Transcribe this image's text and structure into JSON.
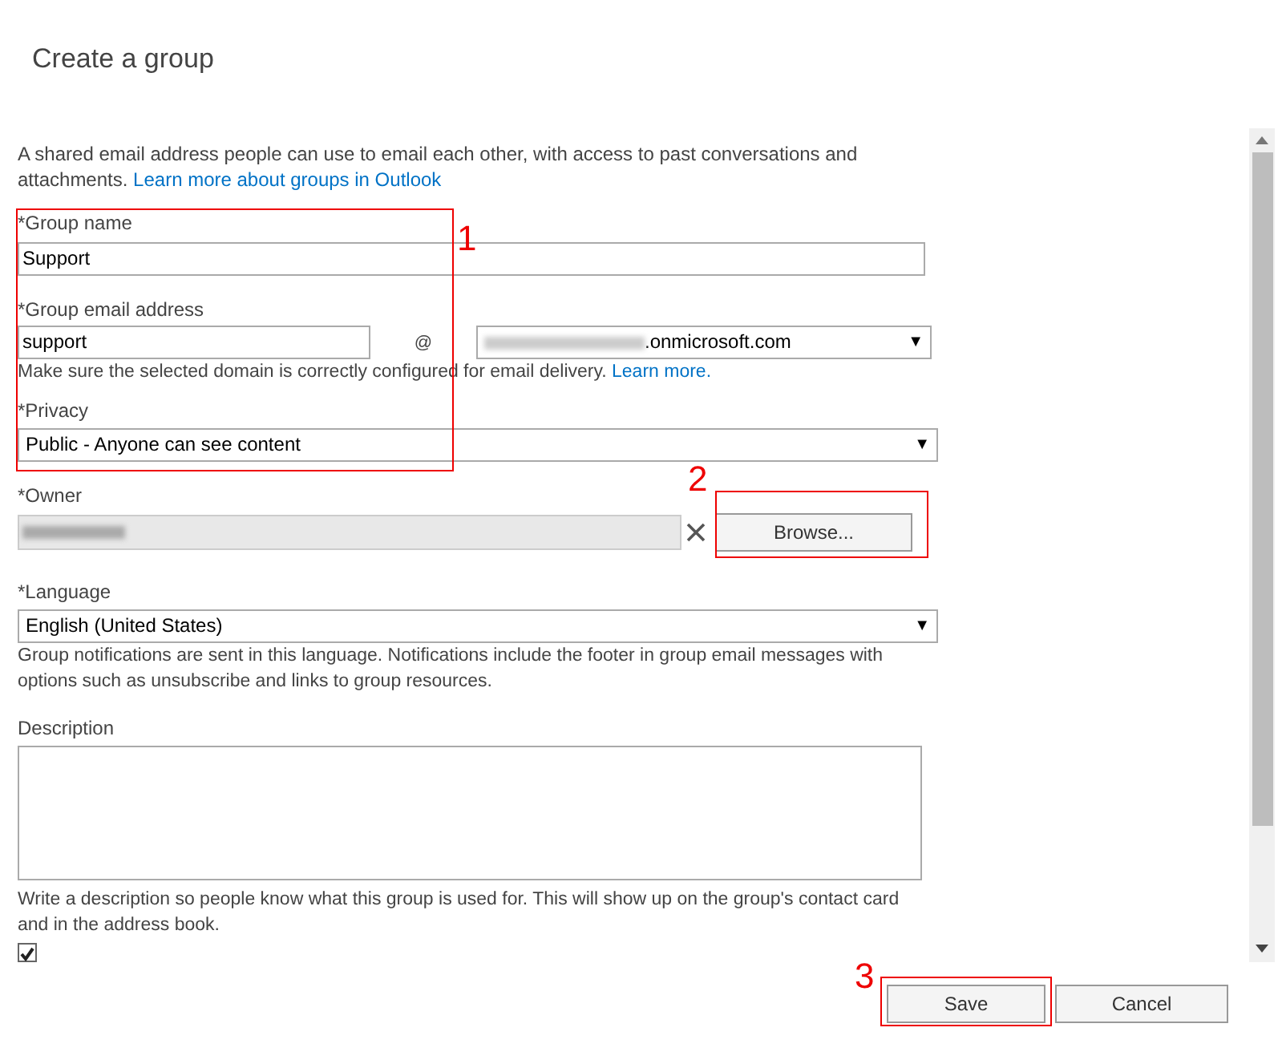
{
  "title": "Create a group",
  "intro": {
    "text": "A shared email address people can use to email each other, with access to past conversations and attachments.",
    "link": "Learn more about groups in Outlook"
  },
  "group_name": {
    "label": "*Group name",
    "value": "Support"
  },
  "email": {
    "label": "*Group email address",
    "value": "support",
    "at": "@",
    "domain_suffix": ".onmicrosoft.com",
    "arrow": "▼",
    "hint": "Make sure the selected domain is correctly configured for email delivery.",
    "hint_link": "Learn more."
  },
  "privacy": {
    "label": "*Privacy",
    "value": "Public - Anyone can see content",
    "arrow": "▼"
  },
  "owner": {
    "label": "*Owner",
    "browse": "Browse..."
  },
  "language": {
    "label": "*Language",
    "value": "English (United States)",
    "arrow": "▼",
    "hint": "Group notifications are sent in this language. Notifications include the footer in group email messages with options such as unsubscribe and links to group resources."
  },
  "description": {
    "label": "Description",
    "hint": "Write a description so people know what this group is used for. This will show up on the group's contact card and in the address book."
  },
  "subscribe": {
    "checked": true
  },
  "buttons": [
    {
      "label": "Save"
    },
    {
      "label": "Cancel"
    }
  ],
  "annotations": [
    {
      "number": "1"
    },
    {
      "number": "2"
    },
    {
      "number": "3"
    }
  ]
}
